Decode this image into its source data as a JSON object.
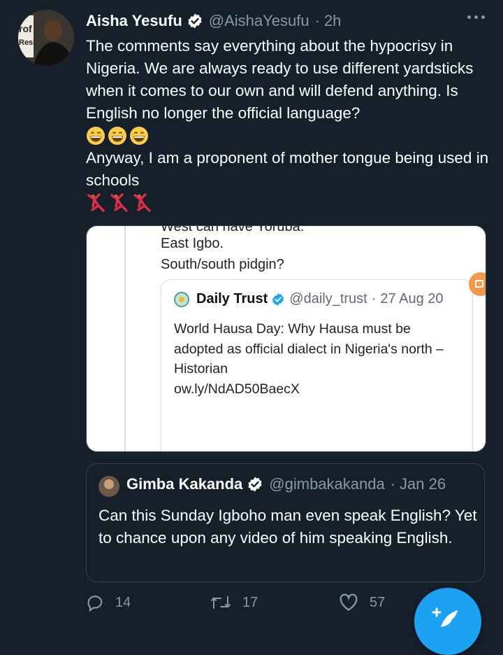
{
  "tweet": {
    "display_name": "Aisha Yesufu",
    "handle": "@AishaYesufu",
    "separator": "·",
    "time": "2h",
    "avatar_text_1": "rof",
    "avatar_text_2": "Resi",
    "text_para1": "The comments say everything about the hypocrisy in Nigeria. We are always ready to use different yardsticks when it comes to our own and will defend anything. Is English no longer the official language?",
    "emoji_row1": [
      "grinning-face-emoji",
      "grinning-face-emoji",
      "grinning-face-emoji"
    ],
    "text_para2": "Anyway, I am a proponent of mother tongue being used in schools",
    "emoji_row2": [
      "dancer-emoji",
      "dancer-emoji",
      "dancer-emoji"
    ]
  },
  "media": {
    "cut_line": "West can have Yoruba.",
    "line1": "East Igbo.",
    "line2": "South/south pidgin?",
    "inner": {
      "name": "Daily Trust",
      "handle": "@daily_trust",
      "separator": "·",
      "date": "27 Aug 20",
      "text": "World Hausa Day: Why Hausa must be adopted as official dialect in Nigeria's north – Historian",
      "link": "ow.ly/NdAD50BaecX"
    }
  },
  "quote": {
    "name": "Gimba Kakanda",
    "handle": "@gimbakakanda",
    "separator": "·",
    "date": "Jan 26",
    "text": "Can this Sunday Igboho man even speak English? Yet to chance upon any video of him speaking English."
  },
  "actions": {
    "replies": "14",
    "retweets": "17",
    "likes": "57"
  },
  "colors": {
    "background": "#15202b",
    "secondary_text": "#8899a6",
    "accent": "#1da1f2"
  }
}
